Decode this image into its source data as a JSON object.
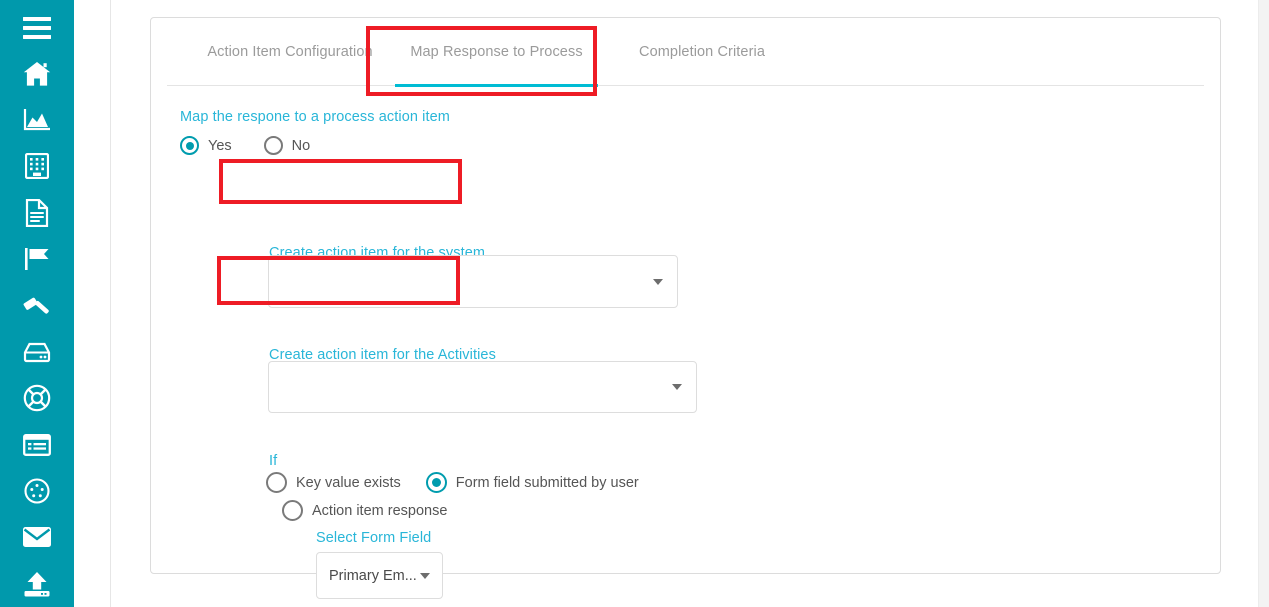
{
  "sidebar": {
    "background_color": "#0099ac",
    "items": [
      {
        "icon": "hamburger-menu-icon",
        "name": "menu"
      },
      {
        "icon": "home-icon",
        "name": "home"
      },
      {
        "icon": "chart-area-icon",
        "name": "analytics"
      },
      {
        "icon": "building-icon",
        "name": "organization"
      },
      {
        "icon": "document-icon",
        "name": "documents"
      },
      {
        "icon": "flag-icon",
        "name": "flags"
      },
      {
        "icon": "gavel-icon",
        "name": "legal"
      },
      {
        "icon": "server-icon",
        "name": "assets"
      },
      {
        "icon": "lifebuoy-icon",
        "name": "support"
      },
      {
        "icon": "list-panel-icon",
        "name": "lists"
      },
      {
        "icon": "compass-icon",
        "name": "navigator"
      },
      {
        "icon": "envelope-icon",
        "name": "mail"
      },
      {
        "icon": "upload-icon",
        "name": "upload"
      }
    ]
  },
  "card": {
    "tabs": [
      {
        "label": "Action Item Configuration",
        "active": false
      },
      {
        "label": "Map Response to Process",
        "active": true
      },
      {
        "label": "Completion Criteria",
        "active": false
      }
    ],
    "active_tab_index": 1,
    "intro_label": "Map the respone to a process action item",
    "map_choice": {
      "options": [
        {
          "label": "Yes",
          "selected": true
        },
        {
          "label": "No",
          "selected": false
        }
      ]
    },
    "system_field": {
      "label": "Create action item for the system",
      "value": "",
      "caret": "chevron-down-icon"
    },
    "activities_field": {
      "label": "Create action item for the Activities",
      "value": "",
      "caret": "chevron-down-icon"
    },
    "condition": {
      "label": "If",
      "options": [
        {
          "label": "Key value exists",
          "selected": false
        },
        {
          "label": "Form field submitted by user",
          "selected": true
        },
        {
          "label": "Action item response",
          "selected": false
        }
      ]
    },
    "form_field": {
      "label": "Select Form Field",
      "value": "Primary Em...",
      "caret": "chevron-down-icon"
    }
  },
  "annotations": {
    "color": "#ee1c25",
    "boxes": [
      {
        "target": "tab-map-response-to-process"
      },
      {
        "target": "label-create-action-item-for-the-system"
      },
      {
        "target": "label-create-action-item-for-the-activities"
      }
    ]
  },
  "theme": {
    "sidebar": "#0099ac",
    "accent_text": "#29b6d8",
    "tab_underline": "#00bcd4",
    "radio_selected": "#009cae",
    "annotation": "#ee1c25"
  }
}
